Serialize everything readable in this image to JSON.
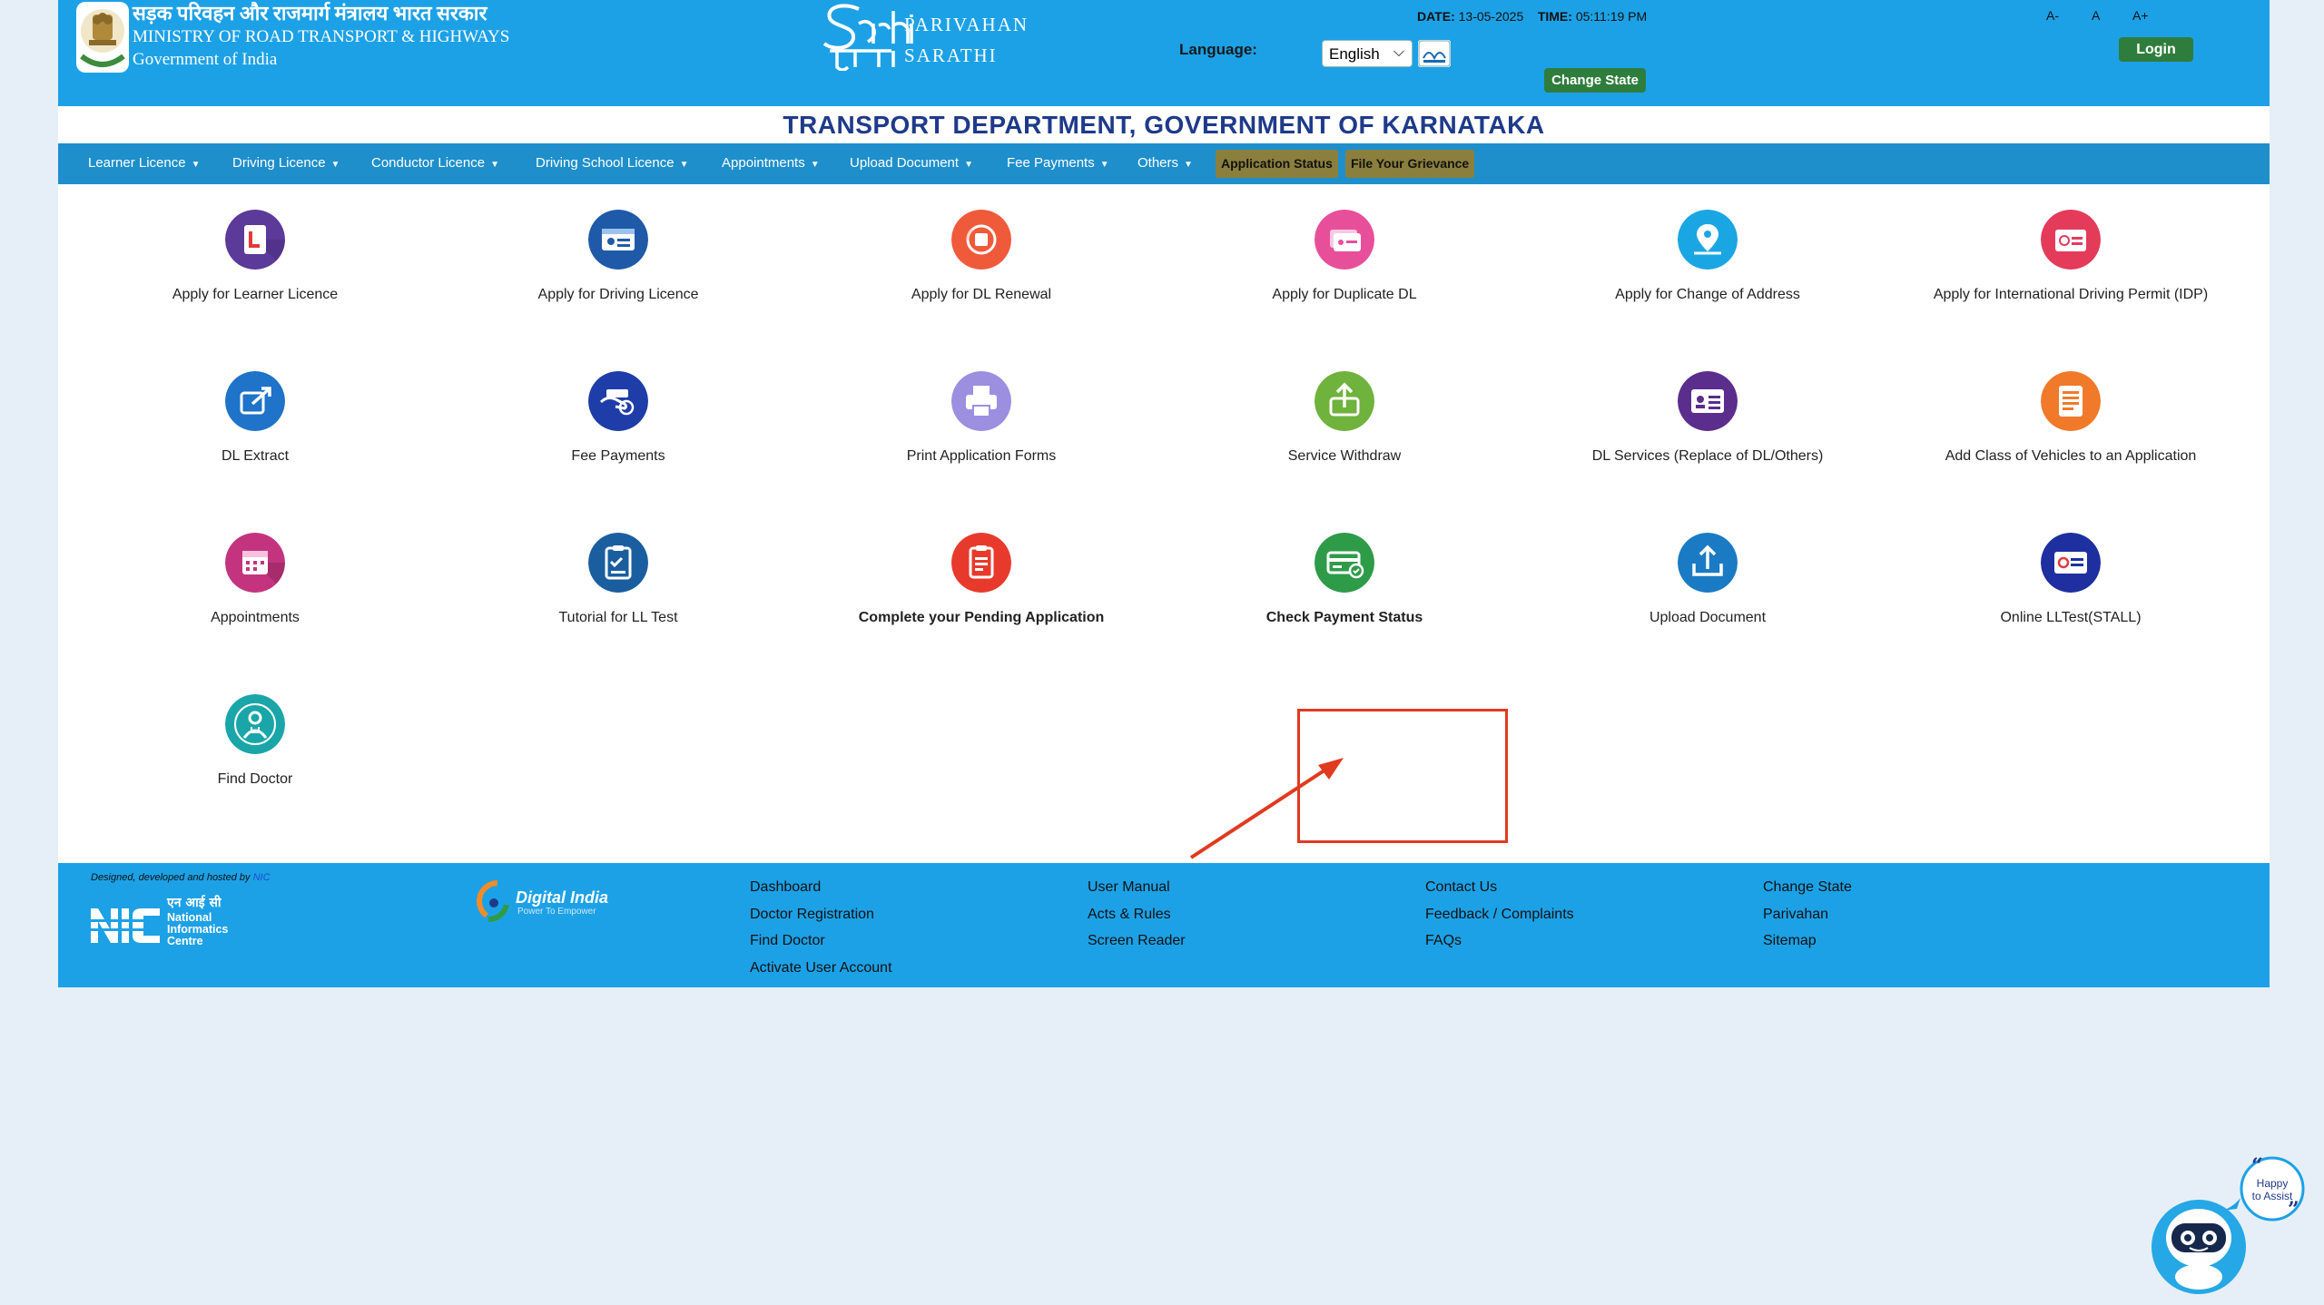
{
  "header": {
    "ministry_hindi": "सड़क परिवहन और राजमार्ग मंत्रालय भारत सरकार",
    "ministry_english": "MINISTRY OF ROAD TRANSPORT & HIGHWAYS",
    "government": "Government of India",
    "logo_word_1": "PARIVAHAN",
    "logo_word_2": "SARATHI",
    "language_label": "Language:",
    "language_value": "English",
    "date_label": "DATE:",
    "date_value": "13-05-2025",
    "time_label": "TIME:",
    "time_value": "05:11:19 PM",
    "font_small": "A-",
    "font_normal": "A",
    "font_large": "A+",
    "change_state": "Change State",
    "login": "Login"
  },
  "department_title": "TRANSPORT DEPARTMENT, GOVERNMENT OF KARNATAKA",
  "nav": {
    "items": [
      "Learner Licence",
      "Driving Licence",
      "Conductor Licence",
      "Driving School Licence",
      "Appointments",
      "Upload Document",
      "Fee Payments",
      "Others"
    ],
    "application_status": "Application Status",
    "grievance": "File Your Grievance"
  },
  "services": [
    {
      "label": "Apply for Learner Licence",
      "icon": "learner-licence-icon",
      "color": "#5b3a9a"
    },
    {
      "label": "Apply for Driving Licence",
      "icon": "driving-licence-icon",
      "color": "#1f5aa8"
    },
    {
      "label": "Apply for DL Renewal",
      "icon": "dl-renewal-icon",
      "color": "#ef5a3a"
    },
    {
      "label": "Apply for Duplicate DL",
      "icon": "duplicate-dl-icon",
      "color": "#e84f9a"
    },
    {
      "label": "Apply for Change of Address",
      "icon": "change-address-icon",
      "color": "#1aa6e3"
    },
    {
      "label": "Apply for International Driving Permit (IDP)",
      "icon": "idp-icon",
      "color": "#e43b5a"
    },
    {
      "label": "DL Extract",
      "icon": "dl-extract-icon",
      "color": "#1f73c8"
    },
    {
      "label": "Fee Payments",
      "icon": "fee-payments-icon",
      "color": "#1f3da8"
    },
    {
      "label": "Print Application Forms",
      "icon": "print-forms-icon",
      "color": "#9c8fe0"
    },
    {
      "label": "Service Withdraw",
      "icon": "service-withdraw-icon",
      "color": "#6fb23c"
    },
    {
      "label": "DL Services (Replace of DL/Others)",
      "icon": "dl-services-icon",
      "color": "#5b2d8c"
    },
    {
      "label": "Add Class of Vehicles to an Application",
      "icon": "add-class-icon",
      "color": "#f07a2a"
    },
    {
      "label": "Appointments",
      "icon": "appointments-icon",
      "color": "#c4347e"
    },
    {
      "label": "Tutorial for LL Test",
      "icon": "tutorial-icon",
      "color": "#1a5ea0"
    },
    {
      "label": "Complete your Pending Application",
      "icon": "pending-application-icon",
      "color": "#e83a2c",
      "bold": true
    },
    {
      "label": "Check Payment Status",
      "icon": "payment-status-icon",
      "color": "#2e9b48",
      "bold": true
    },
    {
      "label": "Upload Document",
      "icon": "upload-document-icon",
      "color": "#1a7bc4"
    },
    {
      "label": "Online LLTest(STALL)",
      "icon": "online-lltest-icon",
      "color": "#1e2fa0"
    },
    {
      "label": "Find Doctor",
      "icon": "find-doctor-icon",
      "color": "#1aa6a8"
    }
  ],
  "footer": {
    "designed_by": "Designed, developed and hosted by",
    "nic_short": "NIC",
    "nic_name": "National Informatics Centre",
    "nic_hindi": "एन आई सी",
    "digital_india": "Digital India",
    "digital_india_tagline": "Power To Empower",
    "col1": [
      "Dashboard",
      "Doctor Registration",
      "Find Doctor",
      "Activate User Account"
    ],
    "col2": [
      "User Manual",
      "Acts & Rules",
      "Screen Reader"
    ],
    "col3": [
      "Contact Us",
      "Feedback / Complaints",
      "FAQs"
    ],
    "col4": [
      "Change State",
      "Parivahan",
      "Sitemap"
    ]
  },
  "assistant": {
    "bubble_line1": "Happy",
    "bubble_line2": "to Assist"
  }
}
